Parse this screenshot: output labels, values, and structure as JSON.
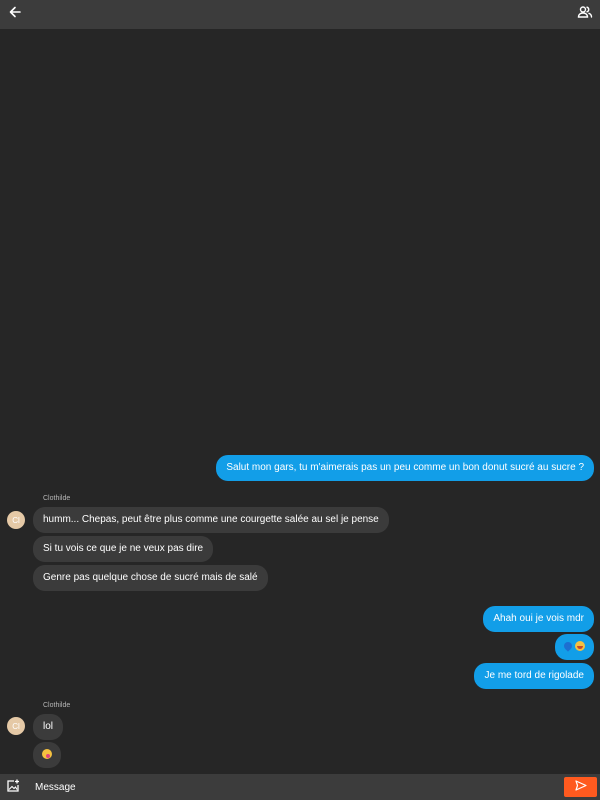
{
  "header": {
    "back_icon": "arrow-left-icon",
    "members_icon": "people-icon"
  },
  "messages": [
    {
      "direction": "outgoing",
      "text": "Salut mon gars, tu m'aimerais pas un peu comme un bon donut sucré au sucre ?"
    },
    {
      "direction": "incoming",
      "sender": "Clothilde",
      "avatar": "Cl",
      "text": "humm... Chepas, peut être plus comme une courgette salée au sel je pense"
    },
    {
      "direction": "incoming",
      "text": "Si tu vois ce que je ne veux pas dire"
    },
    {
      "direction": "incoming",
      "text": "Genre pas quelque chose de sucré mais de salé"
    },
    {
      "direction": "outgoing",
      "text": "Ahah oui je vois mdr"
    },
    {
      "direction": "outgoing",
      "emoji": [
        "blue-droplet-emoji",
        "laughing-face-emoji"
      ]
    },
    {
      "direction": "outgoing",
      "text": "Je me tord de rigolade"
    },
    {
      "direction": "incoming",
      "sender": "Clothilde",
      "avatar": "Cl",
      "text": "lol"
    },
    {
      "direction": "incoming",
      "emoji": [
        "face-with-tongue-emoji"
      ]
    }
  ],
  "composer": {
    "attach_icon": "add-image-icon",
    "placeholder": "Message",
    "send_icon": "send-icon"
  },
  "colors": {
    "background": "#262626",
    "bar": "#3c3c3c",
    "outgoing_bubble": "#129ee8",
    "incoming_bubble": "#3b3b3b",
    "send_button": "#ff5a1f"
  }
}
